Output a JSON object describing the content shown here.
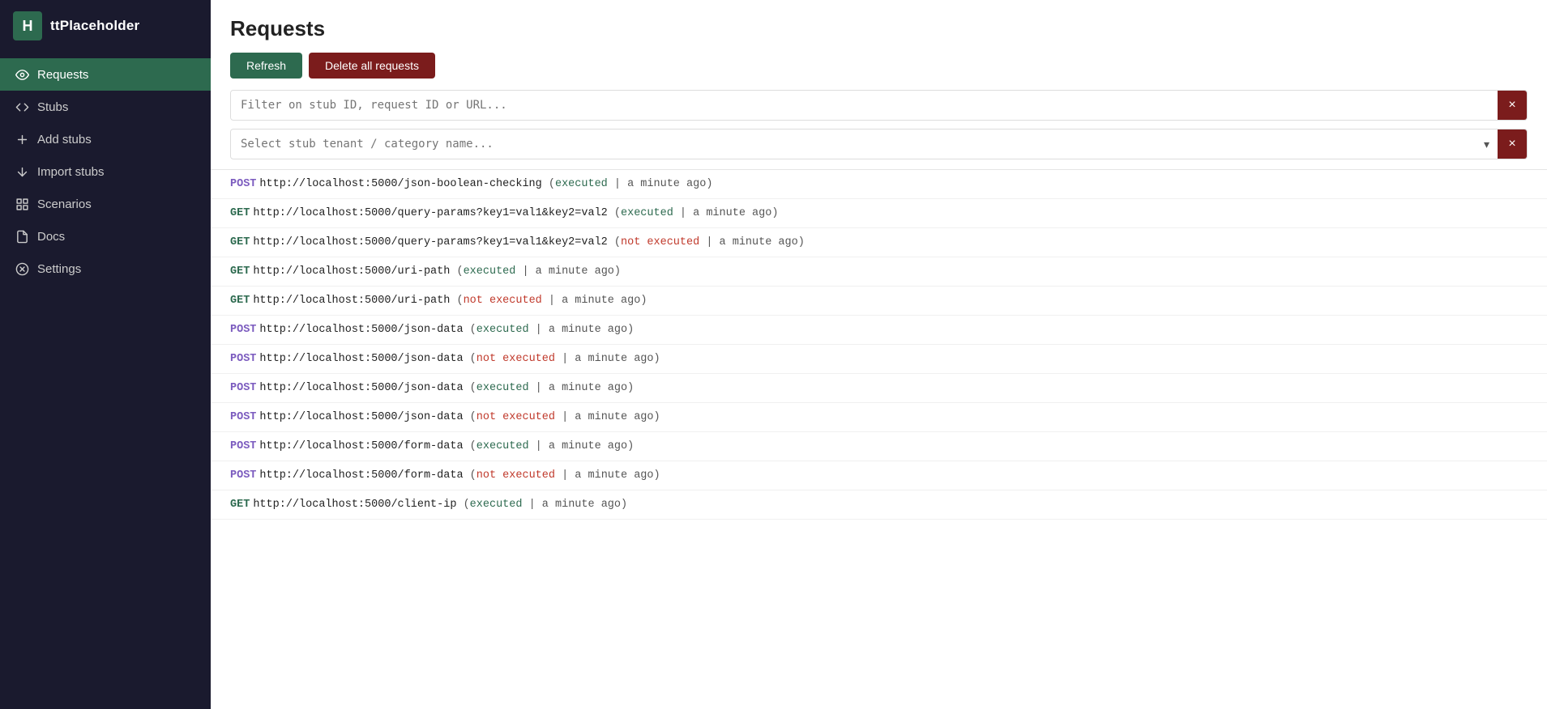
{
  "app": {
    "logo": "H",
    "title": "ttPlaceholder"
  },
  "sidebar": {
    "items": [
      {
        "label": "Requests",
        "icon": "eye-icon",
        "active": true,
        "id": "requests"
      },
      {
        "label": "Stubs",
        "icon": "code-icon",
        "active": false,
        "id": "stubs"
      },
      {
        "label": "Add stubs",
        "icon": "plus-icon",
        "active": false,
        "id": "add-stubs"
      },
      {
        "label": "Import stubs",
        "icon": "import-icon",
        "active": false,
        "id": "import-stubs"
      },
      {
        "label": "Scenarios",
        "icon": "scenarios-icon",
        "active": false,
        "id": "scenarios"
      },
      {
        "label": "Docs",
        "icon": "docs-icon",
        "active": false,
        "id": "docs"
      },
      {
        "label": "Settings",
        "icon": "settings-icon",
        "active": false,
        "id": "settings"
      }
    ]
  },
  "main": {
    "page_title": "Requests",
    "toolbar": {
      "refresh_label": "Refresh",
      "delete_label": "Delete all requests"
    },
    "filter": {
      "placeholder": "Filter on stub ID, request ID or URL...",
      "value": "",
      "clear_label": "×"
    },
    "tenant_select": {
      "placeholder": "Select stub tenant / category name...",
      "value": "",
      "clear_label": "×"
    },
    "requests": [
      {
        "method": "POST",
        "url": "http://localhost:5000/json-boolean-checking",
        "status": "executed",
        "time": "a minute ago"
      },
      {
        "method": "GET",
        "url": "http://localhost:5000/query-params?key1=val1&key2=val2",
        "status": "executed",
        "time": "a minute ago"
      },
      {
        "method": "GET",
        "url": "http://localhost:5000/query-params?key1=val1&key2=val2",
        "status": "not executed",
        "time": "a minute ago"
      },
      {
        "method": "GET",
        "url": "http://localhost:5000/uri-path",
        "status": "executed",
        "time": "a minute ago"
      },
      {
        "method": "GET",
        "url": "http://localhost:5000/uri-path",
        "status": "not executed",
        "time": "a minute ago"
      },
      {
        "method": "POST",
        "url": "http://localhost:5000/json-data",
        "status": "executed",
        "time": "a minute ago"
      },
      {
        "method": "POST",
        "url": "http://localhost:5000/json-data",
        "status": "not executed",
        "time": "a minute ago"
      },
      {
        "method": "POST",
        "url": "http://localhost:5000/json-data",
        "status": "executed",
        "time": "a minute ago"
      },
      {
        "method": "POST",
        "url": "http://localhost:5000/json-data",
        "status": "not executed",
        "time": "a minute ago"
      },
      {
        "method": "POST",
        "url": "http://localhost:5000/form-data",
        "status": "executed",
        "time": "a minute ago"
      },
      {
        "method": "POST",
        "url": "http://localhost:5000/form-data",
        "status": "not executed",
        "time": "a minute ago"
      },
      {
        "method": "GET",
        "url": "http://localhost:5000/client-ip",
        "status": "executed",
        "time": "a minute ago"
      }
    ]
  }
}
